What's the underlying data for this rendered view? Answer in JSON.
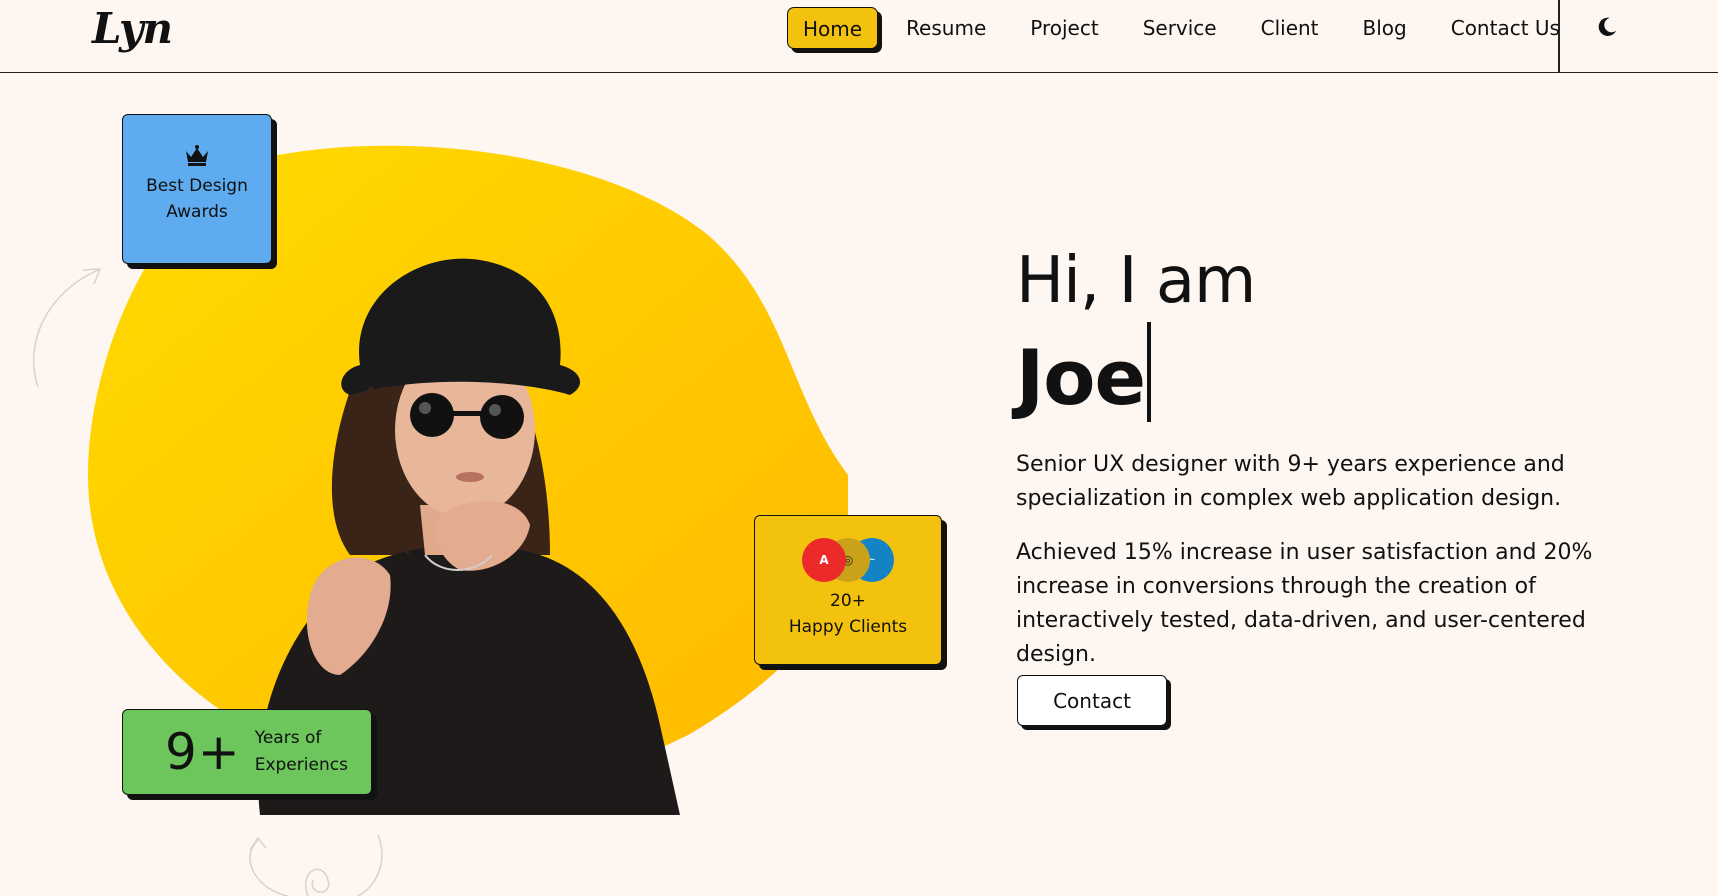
{
  "header": {
    "logo": "Lyn",
    "nav": [
      "Home",
      "Resume",
      "Project",
      "Service",
      "Client",
      "Blog",
      "Contact Us"
    ],
    "active": "Home",
    "theme_toggle_icon": "moon-icon"
  },
  "hero": {
    "greeting": "Hi, I am",
    "name": "Joe",
    "paragraph1": "Senior UX designer with 9+ years experience and specialization in complex web application design.",
    "paragraph2": "Achieved 15% increase in user satisfaction and 20% increase in conversions through the creation of interactively tested, data-driven, and user-centered design.",
    "contact_button": "Contact"
  },
  "cards": {
    "awards": {
      "icon": "crown-icon",
      "label": "Best Design Awards",
      "color": "#5eacef"
    },
    "clients": {
      "count": "20+",
      "label": "Happy Clients",
      "color": "#f2c20e",
      "logos": [
        "adobe-logo",
        "client-logo",
        "disney-logo"
      ]
    },
    "years": {
      "number": "9+",
      "label": "Years of Experiencs",
      "color": "#6cc65b"
    }
  },
  "colors": {
    "background": "#fdf6f1",
    "accent": "#f2c20e",
    "blob": "#ffc400",
    "text": "#111111"
  }
}
